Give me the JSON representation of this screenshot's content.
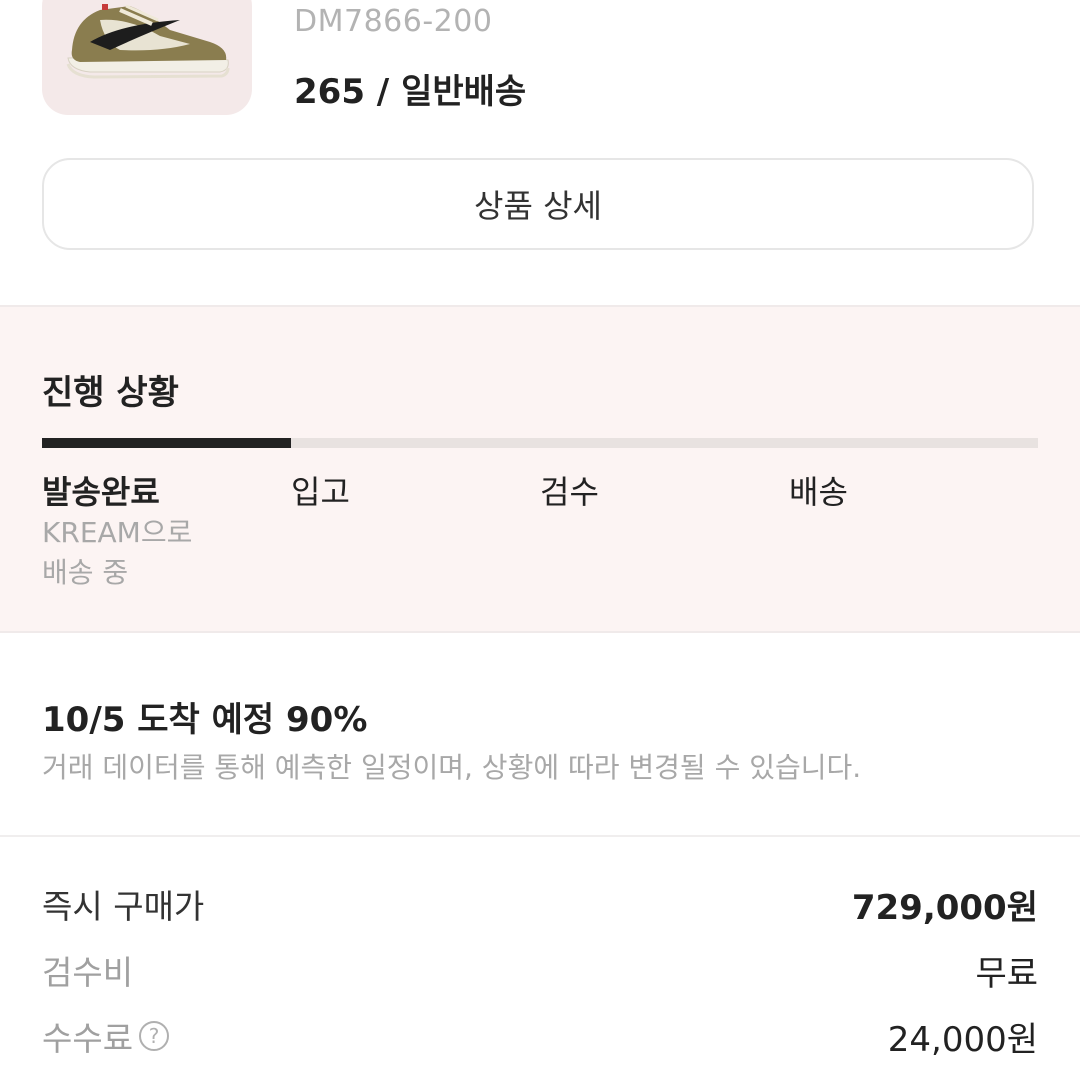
{
  "product": {
    "model_number": "DM7866-200",
    "option": "265 / 일반배송",
    "image_icon": "sneaker-image"
  },
  "detail_button": {
    "label": "상품 상세"
  },
  "progress": {
    "title": "진행 상황",
    "completed_fraction": 0.25,
    "steps": [
      {
        "label": "발송완료",
        "active": true
      },
      {
        "label": "입고",
        "active": false
      },
      {
        "label": "검수",
        "active": false
      },
      {
        "label": "배송",
        "active": false
      }
    ],
    "active_desc_line1": "KREAM으로",
    "active_desc_line2": "배송 중"
  },
  "estimate": {
    "title": "10/5 도착 예정 90%",
    "note": "거래 데이터를 통해 예측한 일정이며, 상황에 따라 변경될 수 있습니다."
  },
  "pricing": {
    "buy_now_label": "즉시 구매가",
    "buy_now_value": "729,000원",
    "inspection_label": "검수비",
    "inspection_value": "무료",
    "fee_label": "수수료",
    "fee_value": "24,000원",
    "fee_help_icon": "question-circle-icon"
  },
  "colors": {
    "progress_bg": "#fcf4f3",
    "thumb_bg": "#f4e9e9",
    "track_done": "#222222",
    "track_todo": "#e8e2e0"
  }
}
